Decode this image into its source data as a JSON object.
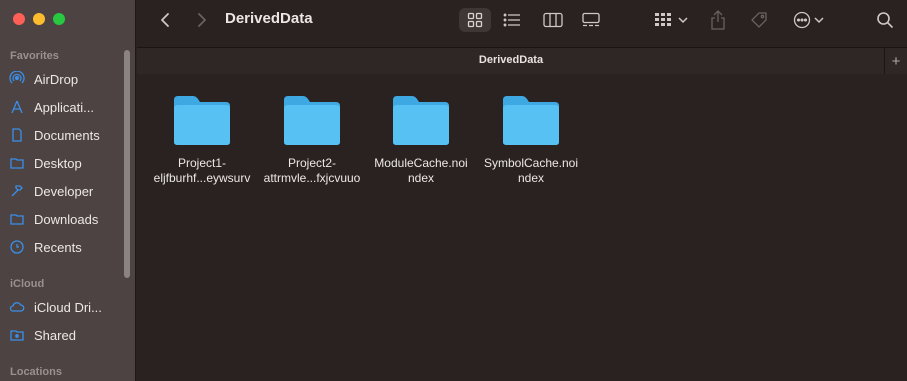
{
  "window": {
    "title": "DerivedData"
  },
  "sidebar": {
    "sections": [
      {
        "label": "Favorites"
      },
      {
        "label": "iCloud"
      },
      {
        "label": "Locations"
      }
    ],
    "favorites": [
      {
        "label": "AirDrop",
        "icon": "airdrop-icon"
      },
      {
        "label": "Applicati...",
        "icon": "applications-icon"
      },
      {
        "label": "Documents",
        "icon": "document-icon"
      },
      {
        "label": "Desktop",
        "icon": "desktop-icon"
      },
      {
        "label": "Developer",
        "icon": "hammer-icon"
      },
      {
        "label": "Downloads",
        "icon": "downloads-folder-icon"
      },
      {
        "label": "Recents",
        "icon": "clock-icon"
      }
    ],
    "icloud": [
      {
        "label": "iCloud Dri...",
        "icon": "cloud-icon"
      },
      {
        "label": "Shared",
        "icon": "shared-folder-icon"
      }
    ]
  },
  "pathbar": {
    "label": "DerivedData",
    "add": "+"
  },
  "items": [
    {
      "line1": "Project1-",
      "line2": "eljfburhf...eywsurv"
    },
    {
      "line1": "Project2-",
      "line2": "attrmvle...fxjcvuuo"
    },
    {
      "line1": "ModuleCache.noi",
      "line2": "ndex"
    },
    {
      "line1": "SymbolCache.noi",
      "line2": "ndex"
    }
  ],
  "colors": {
    "accent": "#3b8fe8",
    "folder": "#4fb8f0",
    "sidebar_bg": "#4c4342",
    "content_bg": "#2a2221"
  }
}
